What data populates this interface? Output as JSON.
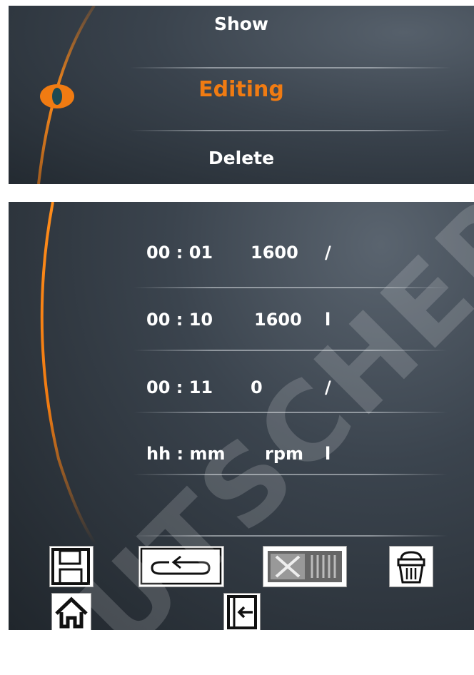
{
  "menu": {
    "items": [
      {
        "label": "Show"
      },
      {
        "label": "Editing"
      },
      {
        "label": "Delete"
      }
    ],
    "selected_index": 1,
    "accent_color": "#f07b12"
  },
  "program": {
    "rows": [
      {
        "time": "00 : 01",
        "speed": "1600",
        "mode": "/"
      },
      {
        "time": "00 : 10",
        "speed": "1600",
        "mode": "l"
      },
      {
        "time": "00 : 11",
        "speed": "0",
        "mode": "/"
      }
    ],
    "header": {
      "time": "hh : mm",
      "speed": "rpm",
      "mode": "l"
    }
  },
  "toolbar": {
    "buttons": [
      "save-icon",
      "return-icon",
      "cancel-icon",
      "delete-icon",
      "home-icon",
      "exit-icon"
    ]
  },
  "watermark": "UTSCHER SAS"
}
